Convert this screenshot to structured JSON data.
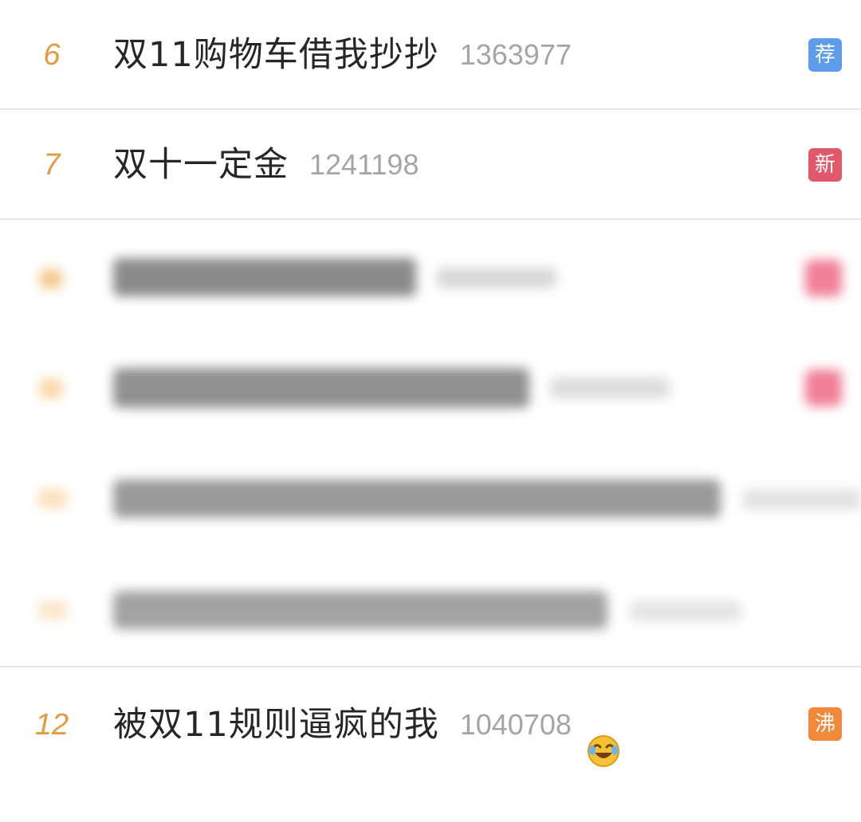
{
  "trending": {
    "items": [
      {
        "rank": "6",
        "title": "双11购物车借我抄抄",
        "count": "1363977",
        "badge": "荐",
        "badge_color": "#5c9ceb",
        "emoji": ""
      },
      {
        "rank": "7",
        "title": "双十一定金",
        "count": "1241198",
        "badge": "新",
        "badge_color": "#e0586a",
        "emoji": ""
      },
      {
        "rank": "",
        "title": "",
        "count": "",
        "badge": "",
        "badge_color": "#f07f98",
        "emoji": ""
      },
      {
        "rank": "",
        "title": "",
        "count": "",
        "badge": "",
        "badge_color": "#f07f98",
        "emoji": ""
      },
      {
        "rank": "",
        "title": "",
        "count": "",
        "badge": "",
        "badge_color": "",
        "emoji": ""
      },
      {
        "rank": "",
        "title": "",
        "count": "",
        "badge": "",
        "badge_color": "",
        "emoji": ""
      },
      {
        "rank": "12",
        "title": "被双11规则逼疯的我",
        "count": "1040708",
        "badge": "沸",
        "badge_color": "#f08a3a",
        "emoji": "laughing-crying-emoji"
      }
    ]
  }
}
